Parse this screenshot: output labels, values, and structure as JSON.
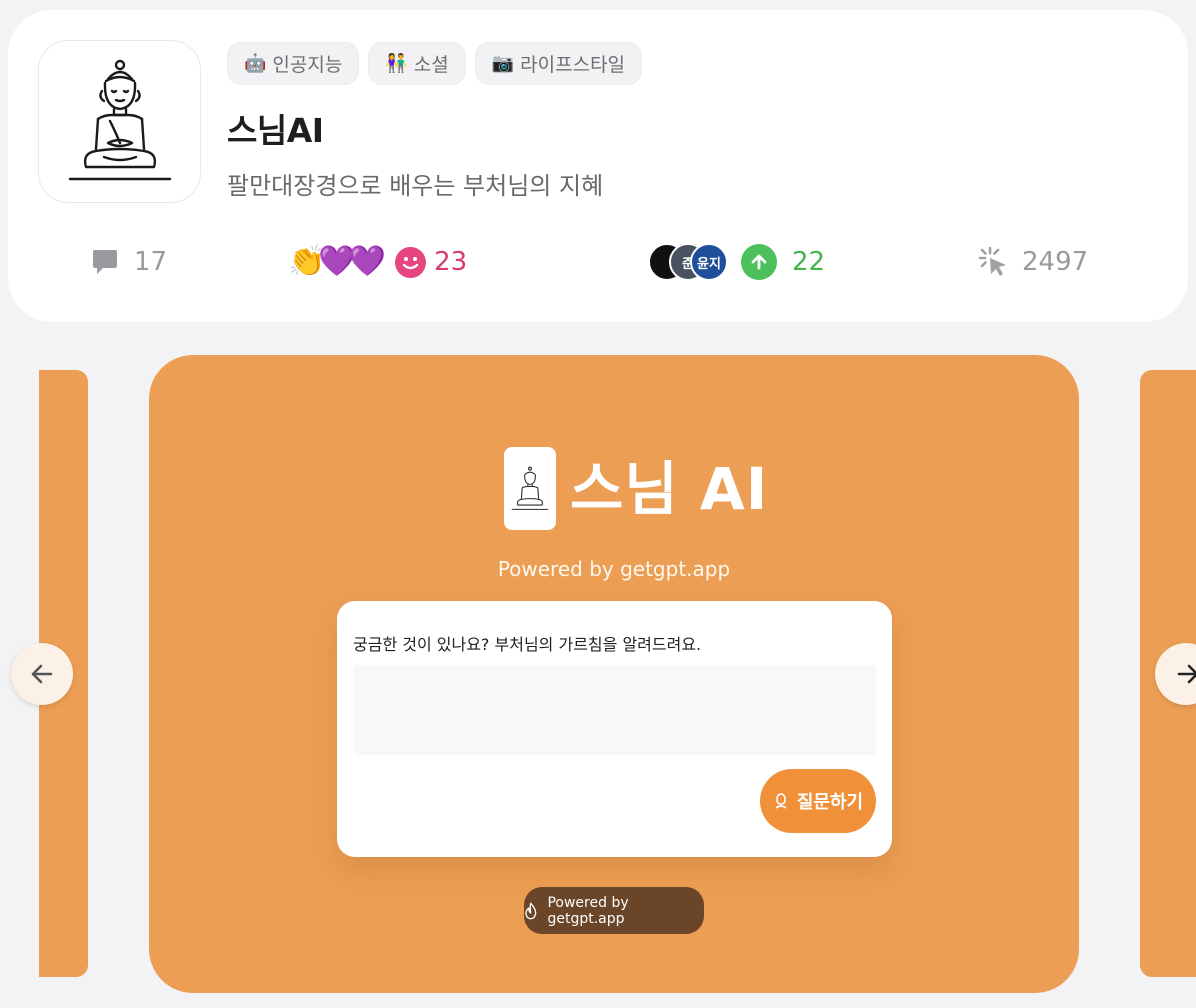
{
  "app": {
    "tags": [
      {
        "icon": "robot-icon",
        "emoji": "🤖",
        "label": "인공지능"
      },
      {
        "icon": "people-icon",
        "emoji": "👫",
        "label": "소셜"
      },
      {
        "icon": "camera-icon",
        "emoji": "📷",
        "label": "라이프스타일"
      }
    ],
    "title": "스님AI",
    "subtitle": "팔만대장경으로 배우는 부처님의 지혜"
  },
  "stats": {
    "comments": "17",
    "reactions": {
      "emojis": [
        "👏",
        "💜",
        "💜"
      ],
      "count": "23"
    },
    "upvotes": {
      "avatars": [
        "",
        "준",
        "윤지"
      ],
      "count": "22"
    },
    "views": "2497"
  },
  "slide": {
    "brand_name": "스님 AI",
    "powered_top": "Powered by getgpt.app",
    "form": {
      "label": "궁금한 것이 있나요? 부처님의 가르침을 알려드려요.",
      "placeholder": "",
      "button_label": "질문하기"
    },
    "badge_label": "Powered by getgpt.app"
  },
  "colors": {
    "slide_bg": "#ec9e54",
    "button": "#f0913a",
    "badge": "#6b4527",
    "reaction": "#d63b73",
    "upvote": "#43b54d"
  }
}
